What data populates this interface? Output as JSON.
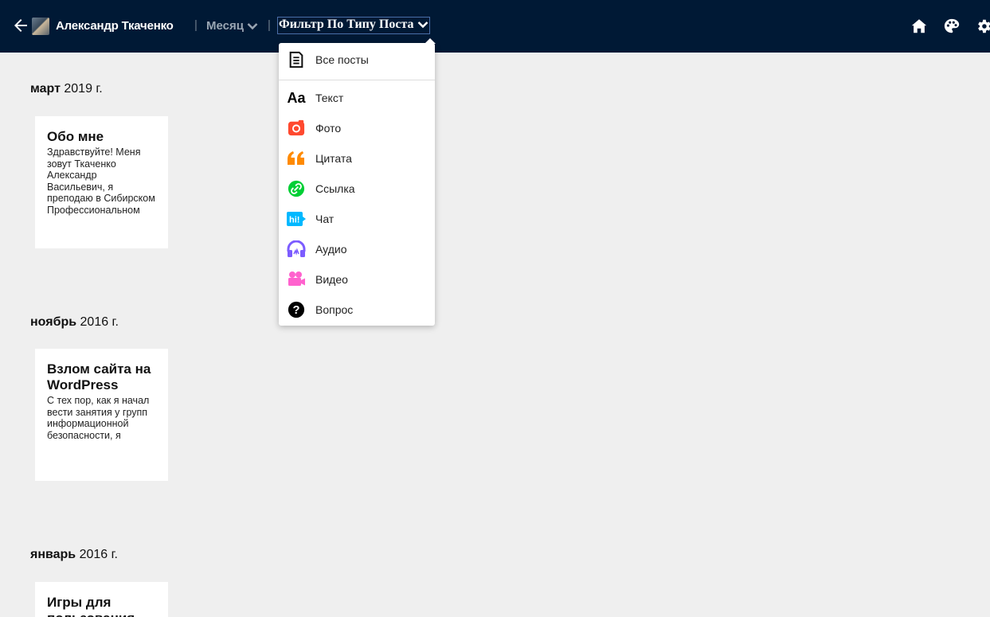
{
  "topbar": {
    "user_name": "Александр Ткаченко",
    "separator": "|",
    "month_link": "Месяц",
    "filter_link": "Фильтр По Типу Поста",
    "icons": [
      "back-arrow-icon",
      "home-icon",
      "palette-icon",
      "gear-icon"
    ],
    "background": "#001935"
  },
  "filter_menu": {
    "all_posts": "Все посты",
    "items": [
      {
        "label": "Текст",
        "icon": "text-icon",
        "color": "#000000"
      },
      {
        "label": "Фото",
        "icon": "camera-icon",
        "color": "#ff492f"
      },
      {
        "label": "Цитата",
        "icon": "quote-icon",
        "color": "#ff8a00"
      },
      {
        "label": "Ссылка",
        "icon": "link-icon",
        "color": "#00cf35"
      },
      {
        "label": "Чат",
        "icon": "chat-icon",
        "color": "#00b8ff"
      },
      {
        "label": "Аудио",
        "icon": "headphones-icon",
        "color": "#7c5cff"
      },
      {
        "label": "Видео",
        "icon": "video-icon",
        "color": "#ff62ce"
      },
      {
        "label": "Вопрос",
        "icon": "question-icon",
        "color": "#000000"
      }
    ]
  },
  "archive": [
    {
      "month": "март",
      "year": "2019 г.",
      "post": {
        "title": "Обо мне",
        "excerpt": "Здравствуйте! Меня зовут Ткаченко Александр Васильевич, я преподаю в Сибирском Профессиональном"
      }
    },
    {
      "month": "ноябрь",
      "year": "2016 г.",
      "post": {
        "title": "Взлом сайта на WordPress",
        "excerpt": "С тех пор, как я начал вести занятия у групп информационной безопасности, я"
      }
    },
    {
      "month": "январь",
      "year": "2016 г.",
      "post": {
        "title": "Игры для пользования",
        "excerpt": ""
      }
    }
  ]
}
